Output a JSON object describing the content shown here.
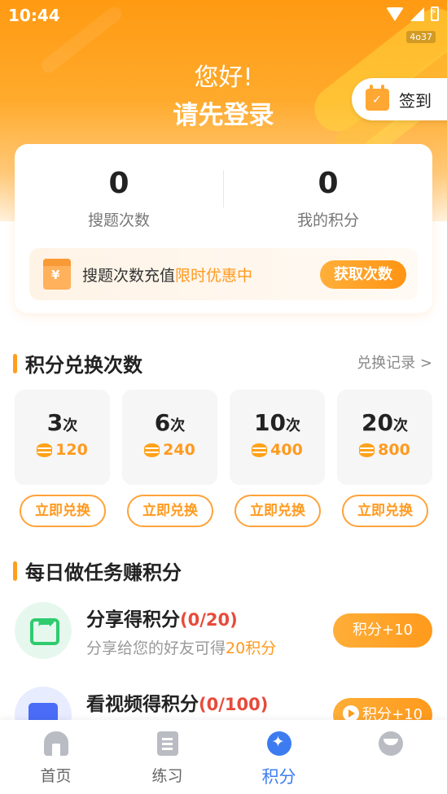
{
  "status_bar": {
    "time": "10:44",
    "tag": "4o37"
  },
  "header": {
    "greeting": "您好!",
    "title": "请先登录",
    "checkin_label": "签到"
  },
  "stats": {
    "search_count_value": "0",
    "search_count_label": "搜题次数",
    "points_value": "0",
    "points_label": "我的积分"
  },
  "recharge": {
    "text": "搜题次数充值",
    "highlight": "限时优惠中",
    "button": "获取次数"
  },
  "exchange": {
    "title": "积分兑换次数",
    "record_link": "兑换记录 >",
    "unit": "次",
    "items": [
      {
        "count": "3",
        "points": "120",
        "button": "立即兑换"
      },
      {
        "count": "6",
        "points": "240",
        "button": "立即兑换"
      },
      {
        "count": "10",
        "points": "400",
        "button": "立即兑换"
      },
      {
        "count": "20",
        "points": "800",
        "button": "立即兑换"
      }
    ]
  },
  "tasks": {
    "title": "每日做任务赚积分",
    "items": [
      {
        "name": "分享得积分",
        "progress": "(0/20)",
        "desc": "分享给您的好友可得",
        "desc_highlight": "20积分",
        "button": "积分+10",
        "icon": "share-icon"
      },
      {
        "name": "看视频得积分",
        "progress": "(0/100)",
        "button": "积分+10",
        "icon": "video-icon"
      }
    ]
  },
  "nav": {
    "items": [
      {
        "label": "首页",
        "icon": "home-icon"
      },
      {
        "label": "练习",
        "icon": "practice-icon"
      },
      {
        "label": "积分",
        "icon": "points-icon",
        "active": true
      },
      {
        "label": "",
        "icon": "mine-icon"
      }
    ]
  },
  "colors": {
    "accent": "#ff9a1f",
    "active_nav": "#3d7cf0",
    "progress_red": "#e84a3a"
  }
}
